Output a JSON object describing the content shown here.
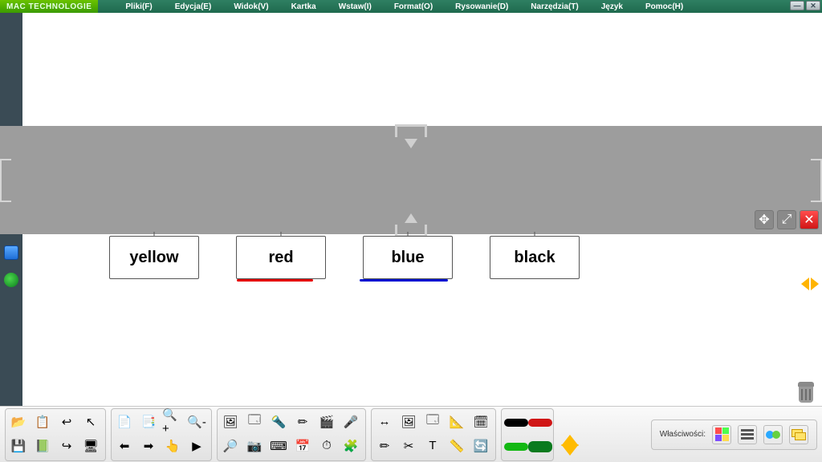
{
  "brand": "MAC TECHNOLOGIE",
  "menu": {
    "pliki": "Pliki(F)",
    "edycja": "Edycja(E)",
    "widok": "Widok(V)",
    "kartka": "Kartka",
    "wstaw": "Wstaw(I)",
    "format": "Format(O)",
    "rysowanie": "Rysowanie(D)",
    "narzedzia": "Narzędzia(T)",
    "jezyk": "Język",
    "pomoc": "Pomoc(H)"
  },
  "cards": {
    "yellow": "yellow",
    "red": "red",
    "blue": "blue",
    "black": "black"
  },
  "properties_label": "Właściwości:",
  "stroke_swatches": {
    "a": "#000000",
    "b": "#d01616",
    "c": "#13b813",
    "d": "#0a7a1e"
  },
  "toolbar_icons": {
    "g1": [
      "📂",
      "📋",
      "↩",
      "↖",
      "📄",
      "📑",
      "🔍+",
      "🔍-"
    ],
    "g1b": [
      "💾",
      "📗",
      "↪",
      "🖥",
      "⬅",
      "➡",
      "👆",
      "▶"
    ],
    "g2": [
      "🖼",
      "🗔",
      "🔦",
      "✏",
      "🎬",
      "🎤",
      "🔎",
      "📷",
      "⌨",
      "📅",
      "⏱",
      "🧩"
    ],
    "g3": [
      "↔",
      "🖼",
      "🗔",
      "📐",
      "🗓",
      "✏",
      "✂",
      "T",
      "📏",
      "🔄"
    ],
    "g4_updown": "⇅"
  }
}
